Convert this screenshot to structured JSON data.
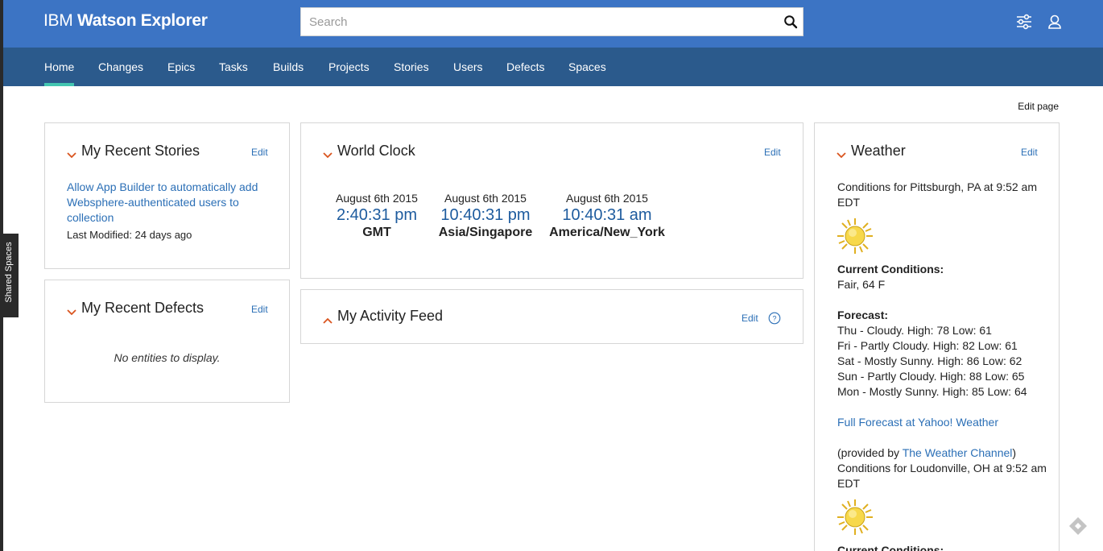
{
  "app": {
    "brand_ibm": "IBM",
    "brand_product": "Watson Explorer"
  },
  "search": {
    "placeholder": "Search"
  },
  "nav": {
    "items": [
      {
        "label": "Home",
        "active": true
      },
      {
        "label": "Changes"
      },
      {
        "label": "Epics"
      },
      {
        "label": "Tasks"
      },
      {
        "label": "Builds"
      },
      {
        "label": "Projects"
      },
      {
        "label": "Stories"
      },
      {
        "label": "Users"
      },
      {
        "label": "Defects"
      },
      {
        "label": "Spaces"
      }
    ]
  },
  "page": {
    "edit_page_label": "Edit page"
  },
  "sidebar_tab": {
    "label": "Shared Spaces"
  },
  "recent_stories": {
    "title": "My Recent Stories",
    "edit_label": "Edit",
    "story_link": "Allow App Builder to automatically add Websphere-authenticated users to collection",
    "story_meta": "Last Modified: 24 days ago"
  },
  "recent_defects": {
    "title": "My Recent Defects",
    "edit_label": "Edit",
    "empty_text": "No entities to display."
  },
  "world_clock": {
    "title": "World Clock",
    "edit_label": "Edit",
    "clocks": [
      {
        "date": "August 6th 2015",
        "time": "2:40:31 pm",
        "zone": "GMT"
      },
      {
        "date": "August 6th 2015",
        "time": "10:40:31 pm",
        "zone": "Asia/Singapore"
      },
      {
        "date": "August 6th 2015",
        "time": "10:40:31 am",
        "zone": "America/New_York"
      }
    ]
  },
  "activity_feed": {
    "title": "My Activity Feed",
    "edit_label": "Edit"
  },
  "weather": {
    "title": "Weather",
    "edit_label": "Edit",
    "conditions_pittsburgh": "Conditions for Pittsburgh, PA at 9:52 am EDT",
    "current_conditions_label": "Current Conditions:",
    "current_conditions_value": "Fair, 64 F",
    "forecast_label": "Forecast:",
    "forecast": [
      "Thu - Cloudy. High: 78 Low: 61",
      "Fri - Partly Cloudy. High: 82 Low: 61",
      "Sat - Mostly Sunny. High: 86 Low: 62",
      "Sun - Partly Cloudy. High: 88 Low: 65",
      "Mon - Mostly Sunny. High: 85 Low: 64"
    ],
    "full_forecast_link": "Full Forecast at Yahoo! Weather",
    "provided_prefix": "(provided by ",
    "provided_link": "The Weather Channel",
    "provided_suffix": ")",
    "conditions_loudonville": "Conditions for Loudonville, OH at 9:52 am EDT",
    "current_conditions_label_2": "Current Conditions:"
  },
  "colors": {
    "topbar": "#3c74c4",
    "navbar": "#2b5a8c",
    "nav_active_underline": "#43c6b1",
    "link": "#2b6fb6",
    "chevron": "#d9541e"
  },
  "icons": [
    "search-icon",
    "filter-settings-icon",
    "user-icon",
    "chevron-down-icon",
    "chevron-up-icon",
    "help-icon",
    "sunny-weather-icon",
    "tag-icon"
  ]
}
